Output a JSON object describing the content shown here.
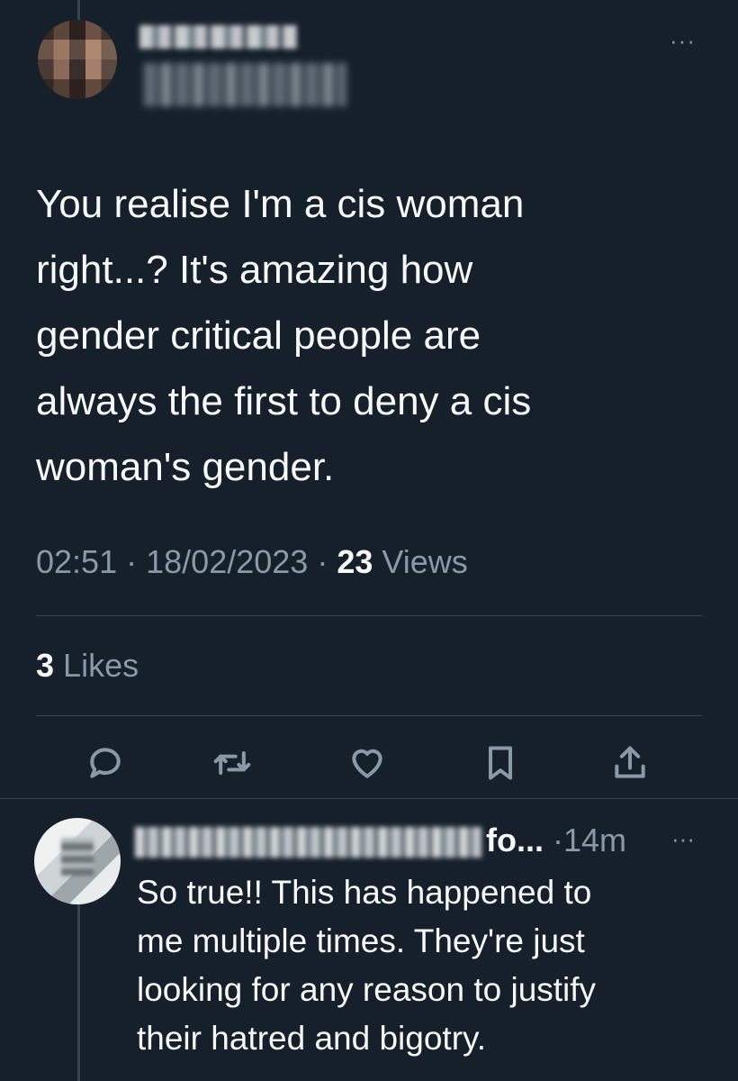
{
  "tweet": {
    "more_icon": "more-horizontal-icon",
    "text": "You realise I'm a cis woman\nright...? It's amazing how\ngender critical people are\nalways the first to deny a cis\nwoman's gender.",
    "time": "02:51",
    "sep": "·",
    "date": "18/02/2023",
    "views_count": "23",
    "views_label": "Views",
    "likes_count": "3",
    "likes_label": "Likes"
  },
  "actions": [
    {
      "name": "reply-icon"
    },
    {
      "name": "retweet-icon"
    },
    {
      "name": "like-icon"
    },
    {
      "name": "bookmark-icon"
    },
    {
      "name": "share-icon"
    }
  ],
  "reply": {
    "author_truncated": "fo...",
    "sep": "·",
    "time": "14m",
    "more": "···",
    "text": "So true!! This has happened to\nme multiple times. They're just\nlooking for any reason to justify\ntheir hatred and bigotry."
  },
  "colors": {
    "background": "#15202b",
    "text_primary": "#f7f9f9",
    "text_secondary": "#8b98a5",
    "divider": "#38444d"
  }
}
